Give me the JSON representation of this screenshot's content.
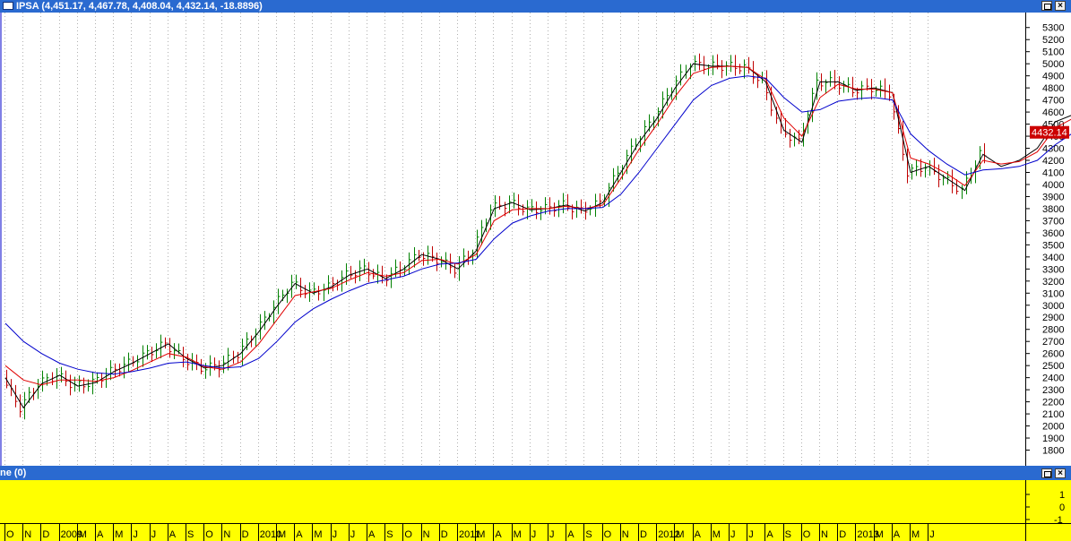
{
  "window": {
    "title": "IPSA (4,451.17, 4,467.78, 4,408.04, 4,432.14, -18.8896)",
    "indicator_title": "ne (0)",
    "close_glyph": "×"
  },
  "colors": {
    "titlebar": "#2a6ad0",
    "up_bar": "#008000",
    "down_bar": "#c00000",
    "close_line": "#000000",
    "ma_fast": "#e00000",
    "ma_slow": "#0000cc",
    "indicator_bg": "#ffff00",
    "price_marker": "#cc0000"
  },
  "chart_data": {
    "type": "line",
    "title": "IPSA (4,451.17, 4,467.78, 4,408.04, 4,432.14, -18.8896)",
    "xlabel": "",
    "ylabel": "",
    "ylim": [
      1700,
      5350
    ],
    "yticks": [
      1800,
      1900,
      2000,
      2100,
      2200,
      2300,
      2400,
      2500,
      2600,
      2700,
      2800,
      2900,
      3000,
      3100,
      3200,
      3300,
      3400,
      3500,
      3600,
      3700,
      3800,
      3900,
      4000,
      4100,
      4200,
      4300,
      4400,
      4500,
      4600,
      4700,
      4800,
      4900,
      5000,
      5100,
      5200,
      5300
    ],
    "last_price_label": "4432.14",
    "last_price": 4432.14,
    "grid": "vertical-dotted",
    "x_labels": [
      "O",
      "N",
      "D",
      "2009",
      "M",
      "A",
      "M",
      "J",
      "J",
      "A",
      "S",
      "O",
      "N",
      "D",
      "2010",
      "M",
      "A",
      "M",
      "J",
      "J",
      "A",
      "S",
      "O",
      "N",
      "D",
      "2011",
      "M",
      "A",
      "M",
      "J",
      "J",
      "A",
      "S",
      "O",
      "N",
      "D",
      "2012",
      "M",
      "A",
      "M",
      "J",
      "J",
      "A",
      "S",
      "O",
      "N",
      "D",
      "2013",
      "M",
      "A",
      "M",
      "J"
    ],
    "month_start": "2008-10",
    "series": [
      {
        "name": "",
        "kind": "close",
        "values": [
          2400,
          2150,
          2350,
          2420,
          2330,
          2360,
          2450,
          2520,
          2600,
          2680,
          2560,
          2480,
          2500,
          2600,
          2780,
          2990,
          3180,
          3100,
          3150,
          3250,
          3300,
          3220,
          3300,
          3420,
          3380,
          3300,
          3450,
          3800,
          3850,
          3790,
          3800,
          3830,
          3780,
          3850,
          4100,
          4350,
          4550,
          4800,
          5000,
          4980,
          4980,
          4970,
          4850,
          4450,
          4350,
          4850,
          4850,
          4780,
          4800,
          4760,
          4100,
          4150,
          4050,
          3950,
          4250,
          4150,
          4200,
          4300,
          4520,
          4580,
          4720,
          4560,
          4450,
          4360,
          4330,
          4200,
          4200,
          4280,
          4300,
          4220,
          4200,
          4250,
          4380,
          4580,
          4560,
          4430
        ]
      },
      {
        "name": "",
        "kind": "ma_fast",
        "values": [
          2500,
          2380,
          2340,
          2380,
          2380,
          2370,
          2400,
          2460,
          2530,
          2600,
          2570,
          2490,
          2470,
          2530,
          2680,
          2880,
          3080,
          3110,
          3140,
          3210,
          3270,
          3240,
          3270,
          3370,
          3380,
          3340,
          3420,
          3700,
          3790,
          3800,
          3800,
          3820,
          3800,
          3830,
          4050,
          4290,
          4500,
          4730,
          4920,
          4970,
          4980,
          4970,
          4870,
          4550,
          4400,
          4720,
          4830,
          4790,
          4790,
          4760,
          4220,
          4170,
          4090,
          3990,
          4200,
          4170,
          4190,
          4270,
          4470,
          4550,
          4680,
          4580,
          4480,
          4380,
          4340,
          4230,
          4210,
          4260,
          4280,
          4230,
          4200,
          4230,
          4340,
          4520,
          4540,
          4450
        ]
      },
      {
        "name": "",
        "kind": "ma_slow",
        "values": [
          2850,
          2700,
          2600,
          2520,
          2470,
          2440,
          2430,
          2450,
          2480,
          2520,
          2530,
          2500,
          2480,
          2490,
          2560,
          2700,
          2860,
          2970,
          3050,
          3120,
          3180,
          3210,
          3240,
          3300,
          3340,
          3350,
          3380,
          3550,
          3680,
          3740,
          3780,
          3800,
          3800,
          3810,
          3920,
          4100,
          4300,
          4500,
          4700,
          4820,
          4880,
          4900,
          4880,
          4720,
          4600,
          4620,
          4690,
          4710,
          4720,
          4700,
          4420,
          4280,
          4170,
          4080,
          4120,
          4130,
          4150,
          4200,
          4330,
          4430,
          4540,
          4520,
          4470,
          4400,
          4360,
          4290,
          4250,
          4260,
          4270,
          4250,
          4220,
          4220,
          4270,
          4380,
          4430,
          4410
        ]
      }
    ],
    "indicator": {
      "ylim": [
        -2,
        2
      ],
      "yticks": [
        1,
        0,
        -1
      ],
      "values": []
    }
  }
}
